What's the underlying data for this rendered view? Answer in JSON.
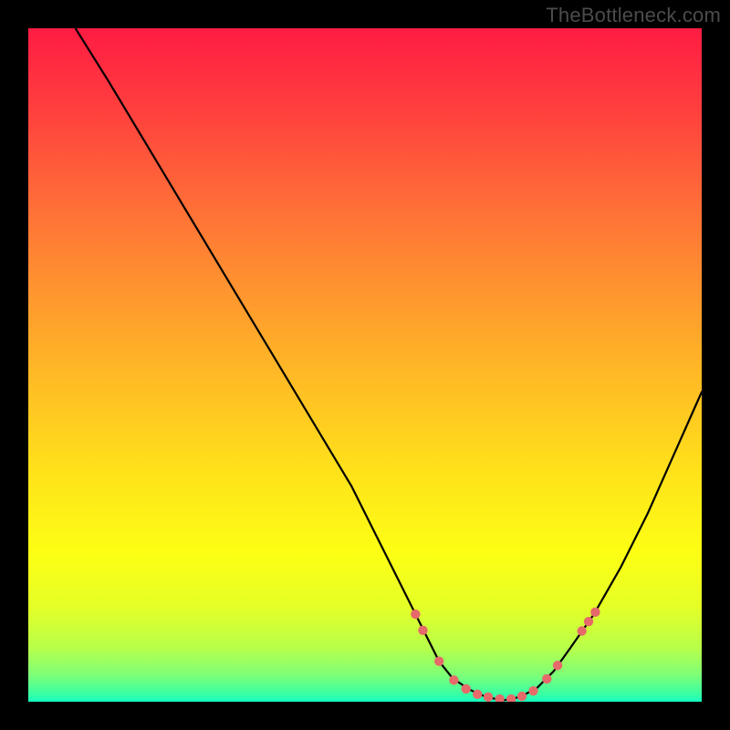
{
  "watermark": "TheBottleneck.com",
  "chart_data": {
    "type": "line",
    "title": "",
    "xlabel": "",
    "ylabel": "",
    "xlim": [
      0,
      100
    ],
    "ylim": [
      0,
      100
    ],
    "series": [
      {
        "name": "curve",
        "x": [
          7,
          12,
          18,
          24,
          30,
          36,
          42,
          48,
          52,
          55,
          57.5,
          59.5,
          61,
          63,
          65.5,
          68,
          70.5,
          73,
          75.5,
          78,
          80.5,
          84,
          88,
          92,
          96,
          100
        ],
        "y": [
          100,
          92,
          82,
          72,
          62,
          52,
          42,
          32,
          24,
          18,
          13,
          9,
          6,
          3.5,
          1.8,
          0.7,
          0.2,
          0.7,
          2,
          4.5,
          8,
          13,
          20,
          28,
          37,
          46
        ]
      }
    ],
    "markers": {
      "name": "dots",
      "color": "#e66a6a",
      "radius_px": 5.2,
      "points": [
        {
          "x": 57.5,
          "y": 13
        },
        {
          "x": 58.6,
          "y": 10.6
        },
        {
          "x": 61,
          "y": 6
        },
        {
          "x": 63.2,
          "y": 3.2
        },
        {
          "x": 65,
          "y": 1.9
        },
        {
          "x": 66.7,
          "y": 1.1
        },
        {
          "x": 68.3,
          "y": 0.7
        },
        {
          "x": 70,
          "y": 0.4
        },
        {
          "x": 71.7,
          "y": 0.4
        },
        {
          "x": 73.3,
          "y": 0.8
        },
        {
          "x": 75,
          "y": 1.6
        },
        {
          "x": 77,
          "y": 3.4
        },
        {
          "x": 78.6,
          "y": 5.4
        },
        {
          "x": 82.2,
          "y": 10.5
        },
        {
          "x": 83.2,
          "y": 11.9
        },
        {
          "x": 84.2,
          "y": 13.3
        }
      ]
    }
  }
}
